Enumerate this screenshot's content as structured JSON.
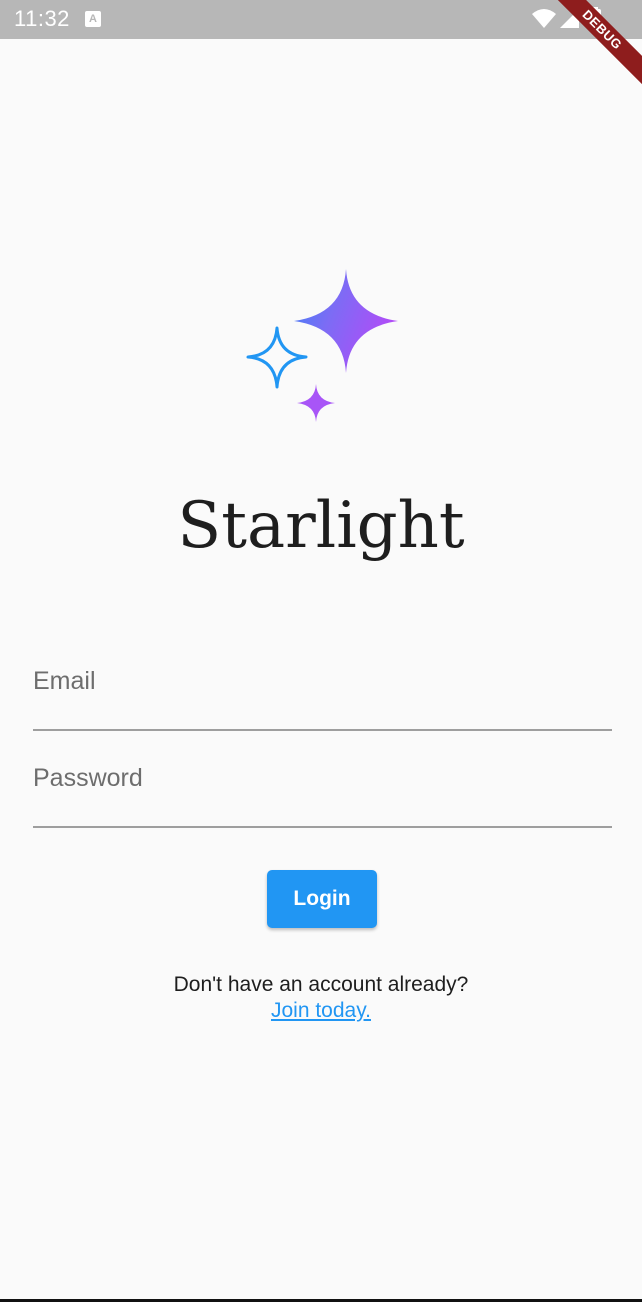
{
  "status_bar": {
    "time": "11:32",
    "notification_icon": "a-icon",
    "icons": [
      "wifi-icon",
      "signal-icon",
      "battery-icon"
    ],
    "debug_banner": "DEBUG"
  },
  "logo": {
    "icon": "sparkle-stars-icon",
    "colors": {
      "blue": "#2196f3",
      "purple": "#a855f7"
    }
  },
  "app": {
    "title": "Starlight"
  },
  "form": {
    "email_placeholder": "Email",
    "password_placeholder": "Password",
    "login_label": "Login"
  },
  "signup": {
    "prompt": "Don't have an account already?",
    "link_label": "Join today."
  },
  "colors": {
    "accent": "#2196f3",
    "background": "#fafafa",
    "status_bar": "#b7b7b7"
  }
}
